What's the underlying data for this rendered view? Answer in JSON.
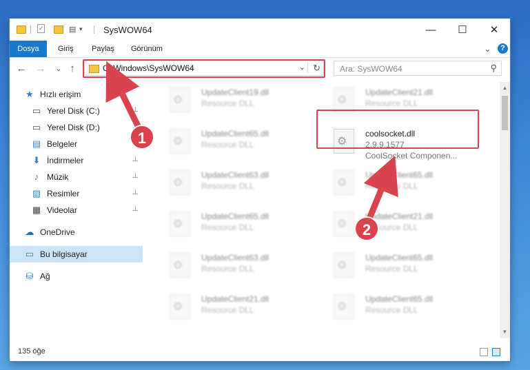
{
  "window": {
    "title": "SysWOW64",
    "minimize_glyph": "—",
    "maximize_glyph": "☐",
    "close_glyph": "✕",
    "tabs": [
      "Dosya",
      "Giriş",
      "Paylaş",
      "Görünüm"
    ],
    "help_glyph": "?",
    "ribbon_expand_glyph": "⌄"
  },
  "navigation": {
    "back_glyph": "←",
    "forward_glyph": "→",
    "recent_glyph": "⌄",
    "up_glyph": "↑",
    "address_path": "C:\\Windows\\SysWOW64",
    "address_dropdown_glyph": "⌄",
    "refresh_glyph": "↻",
    "search_placeholder": "Ara: SysWOW64",
    "search_glyph": "⚲"
  },
  "sidebar": {
    "items": [
      {
        "label": "Hızlı erişim",
        "icon": "star-icon",
        "glyph": "★",
        "color": "#2b7cd3",
        "pinned": false
      },
      {
        "label": "Yerel Disk (C:)",
        "icon": "drive-icon",
        "glyph": "▭",
        "color": "#555555",
        "pinned": true
      },
      {
        "label": "Yerel Disk (D:)",
        "icon": "drive-icon",
        "glyph": "▭",
        "color": "#555555",
        "pinned": true
      },
      {
        "label": "Belgeler",
        "icon": "documents-icon",
        "glyph": "▤",
        "color": "#5a7fa8",
        "pinned": true
      },
      {
        "label": "İndirmeler",
        "icon": "download-icon",
        "glyph": "⬇",
        "color": "#2b7cd3",
        "pinned": true
      },
      {
        "label": "Müzik",
        "icon": "music-icon",
        "glyph": "♪",
        "color": "#2b7cd3",
        "pinned": true
      },
      {
        "label": "Resimler",
        "icon": "pictures-icon",
        "glyph": "▨",
        "color": "#3a8fd6",
        "pinned": true
      },
      {
        "label": "Videolar",
        "icon": "video-icon",
        "glyph": "▦",
        "color": "#444444",
        "pinned": true
      },
      {
        "label": "OneDrive",
        "icon": "cloud-icon",
        "glyph": "☁",
        "color": "#1f6fc5",
        "pinned": false
      },
      {
        "label": "Bu bilgisayar",
        "icon": "computer-icon",
        "glyph": "▭",
        "color": "#2b7cd3",
        "pinned": false,
        "selected": true
      },
      {
        "label": "Ağ",
        "icon": "network-icon",
        "glyph": "⛁",
        "color": "#2b7cd3",
        "pinned": false
      }
    ],
    "pin_glyph": "📌"
  },
  "files": [
    {
      "name": "UpdateClient19.dll",
      "type": "Resource DLL"
    },
    {
      "name": "UpdateClient21.dll",
      "type": "Resource DLL"
    },
    {
      "name": "UpdateClient65.dll",
      "type": "Resource DLL"
    },
    {
      "name": "coolsocket.dll",
      "version": "2.9.9.1577",
      "description": "CoolSocket Componen...",
      "highlighted": true
    },
    {
      "name": "UpdateClient63.dll",
      "type": "Resource DLL"
    },
    {
      "name": "UpdateClient65.dll",
      "type": "Resource DLL"
    },
    {
      "name": "UpdateClient65.dll",
      "type": "Resource DLL"
    },
    {
      "name": "UpdateClient21.dll",
      "type": "Resource DLL"
    },
    {
      "name": "UpdateClient63.dll",
      "type": "Resource DLL"
    },
    {
      "name": "UpdateClient65.dll",
      "type": "Resource DLL"
    },
    {
      "name": "UpdateClient21.dll",
      "type": "Resource DLL"
    },
    {
      "name": "UpdateClient65.dll",
      "type": "Resource DLL"
    }
  ],
  "status": {
    "item_count": "135 öğe"
  },
  "callouts": [
    "1",
    "2"
  ],
  "colors": {
    "accent": "#1979ca",
    "highlight": "#d9434e",
    "selected_bg": "#cce4f7"
  }
}
